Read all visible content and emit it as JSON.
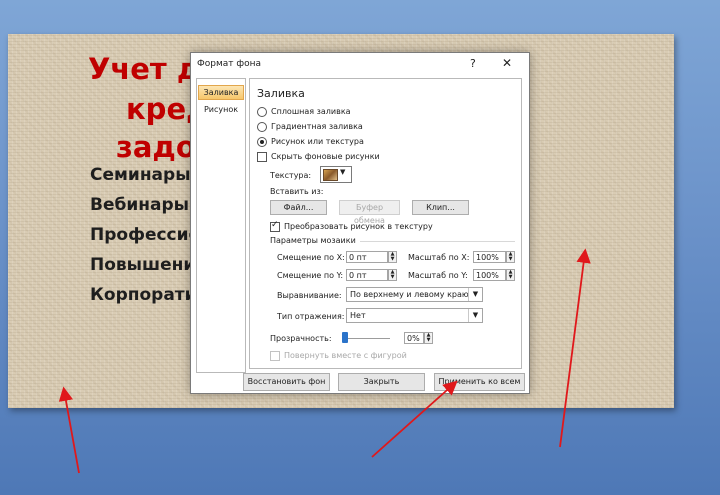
{
  "slide": {
    "title_lines": [
      "Учет де",
      "кред",
      "задол"
    ],
    "bullets": [
      "Семинары.",
      "Вебинары",
      "Профессио",
      "Повышени",
      "Корпорати"
    ]
  },
  "dialog": {
    "title": "Формат фона",
    "help": "?",
    "close": "✕",
    "tabs": [
      "Заливка",
      "Рисунок"
    ],
    "section_title": "Заливка",
    "fill_options": [
      "Сплошная заливка",
      "Градиентная заливка",
      "Рисунок или текстура"
    ],
    "selected_fill": "Рисунок или текстура",
    "hide_bg_label": "Скрыть фоновые рисунки",
    "texture_label": "Текстура:",
    "insert_from_label": "Вставить из:",
    "insert_buttons": [
      "Файл...",
      "Буфер обмена",
      "Клип..."
    ],
    "convert_label": "Преобразовать рисунок в текстуру",
    "tiling_params": "Параметры мозаики",
    "offset_x_label": "Смещение по X:",
    "offset_x_value": "0 пт",
    "offset_y_label": "Смещение по Y:",
    "offset_y_value": "0 пт",
    "scale_x_label": "Масштаб по X:",
    "scale_x_value": "100%",
    "scale_y_label": "Масштаб по Y:",
    "scale_y_value": "100%",
    "align_label": "Выравнивание:",
    "align_value": "По верхнему и левому краю",
    "mirror_label": "Тип отражения:",
    "mirror_value": "Нет",
    "transparency_label": "Прозрачность:",
    "transparency_value": "0%",
    "transparency_level": 0,
    "rotate_label": "Повернуть вместе с фигурой",
    "footer_buttons": [
      "Восстановить фон",
      "Закрыть",
      "Применить ко всем"
    ]
  },
  "colors": {
    "title_red": "#c00000",
    "annotation_arrow": "#e0181b",
    "tab_active": "#f7c66a"
  }
}
